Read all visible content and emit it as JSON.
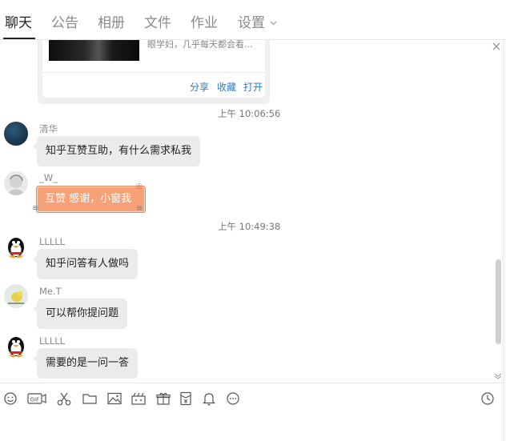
{
  "tabs": [
    {
      "label": "聊天",
      "active": true
    },
    {
      "label": "公告"
    },
    {
      "label": "相册"
    },
    {
      "label": "文件"
    },
    {
      "label": "作业"
    },
    {
      "label": "设置"
    }
  ],
  "card": {
    "text": "眼学妇，几乎每天都会看...",
    "actions": [
      "分享",
      "收藏",
      "打开"
    ]
  },
  "messages": [
    {
      "type": "time",
      "text": "上午 10:06:56"
    },
    {
      "sender": "清华",
      "text": "知乎互赞互助，有什么需求私我",
      "avatar": "dark-blue-avatar"
    },
    {
      "sender": "_W_",
      "text": "互赞 感谢，小窗我",
      "avatar": "sketch-avatar",
      "style": "fancy-bubble"
    },
    {
      "type": "time",
      "text": "上午 10:49:38"
    },
    {
      "sender": "LLLLL",
      "text": "知乎问答有人做吗",
      "avatar": "penguin-avatar"
    },
    {
      "sender": "Me.T",
      "text": "可以帮你提问题",
      "avatar": "bird-avatar"
    },
    {
      "sender": "LLLLL",
      "text": "需要的是一问一答",
      "avatar": "penguin-avatar"
    }
  ],
  "toolbar_icons": [
    "emoji-icon",
    "gif-icon",
    "scissors-icon",
    "folder-icon",
    "image-icon",
    "video-icon",
    "gift-icon",
    "red-packet-icon",
    "bell-icon",
    "more-icon",
    "history-clock-icon"
  ],
  "colors": {
    "link": "#2d7bc1",
    "bubble": "#ebebeb",
    "fancy_bubble": "#f7a178"
  }
}
